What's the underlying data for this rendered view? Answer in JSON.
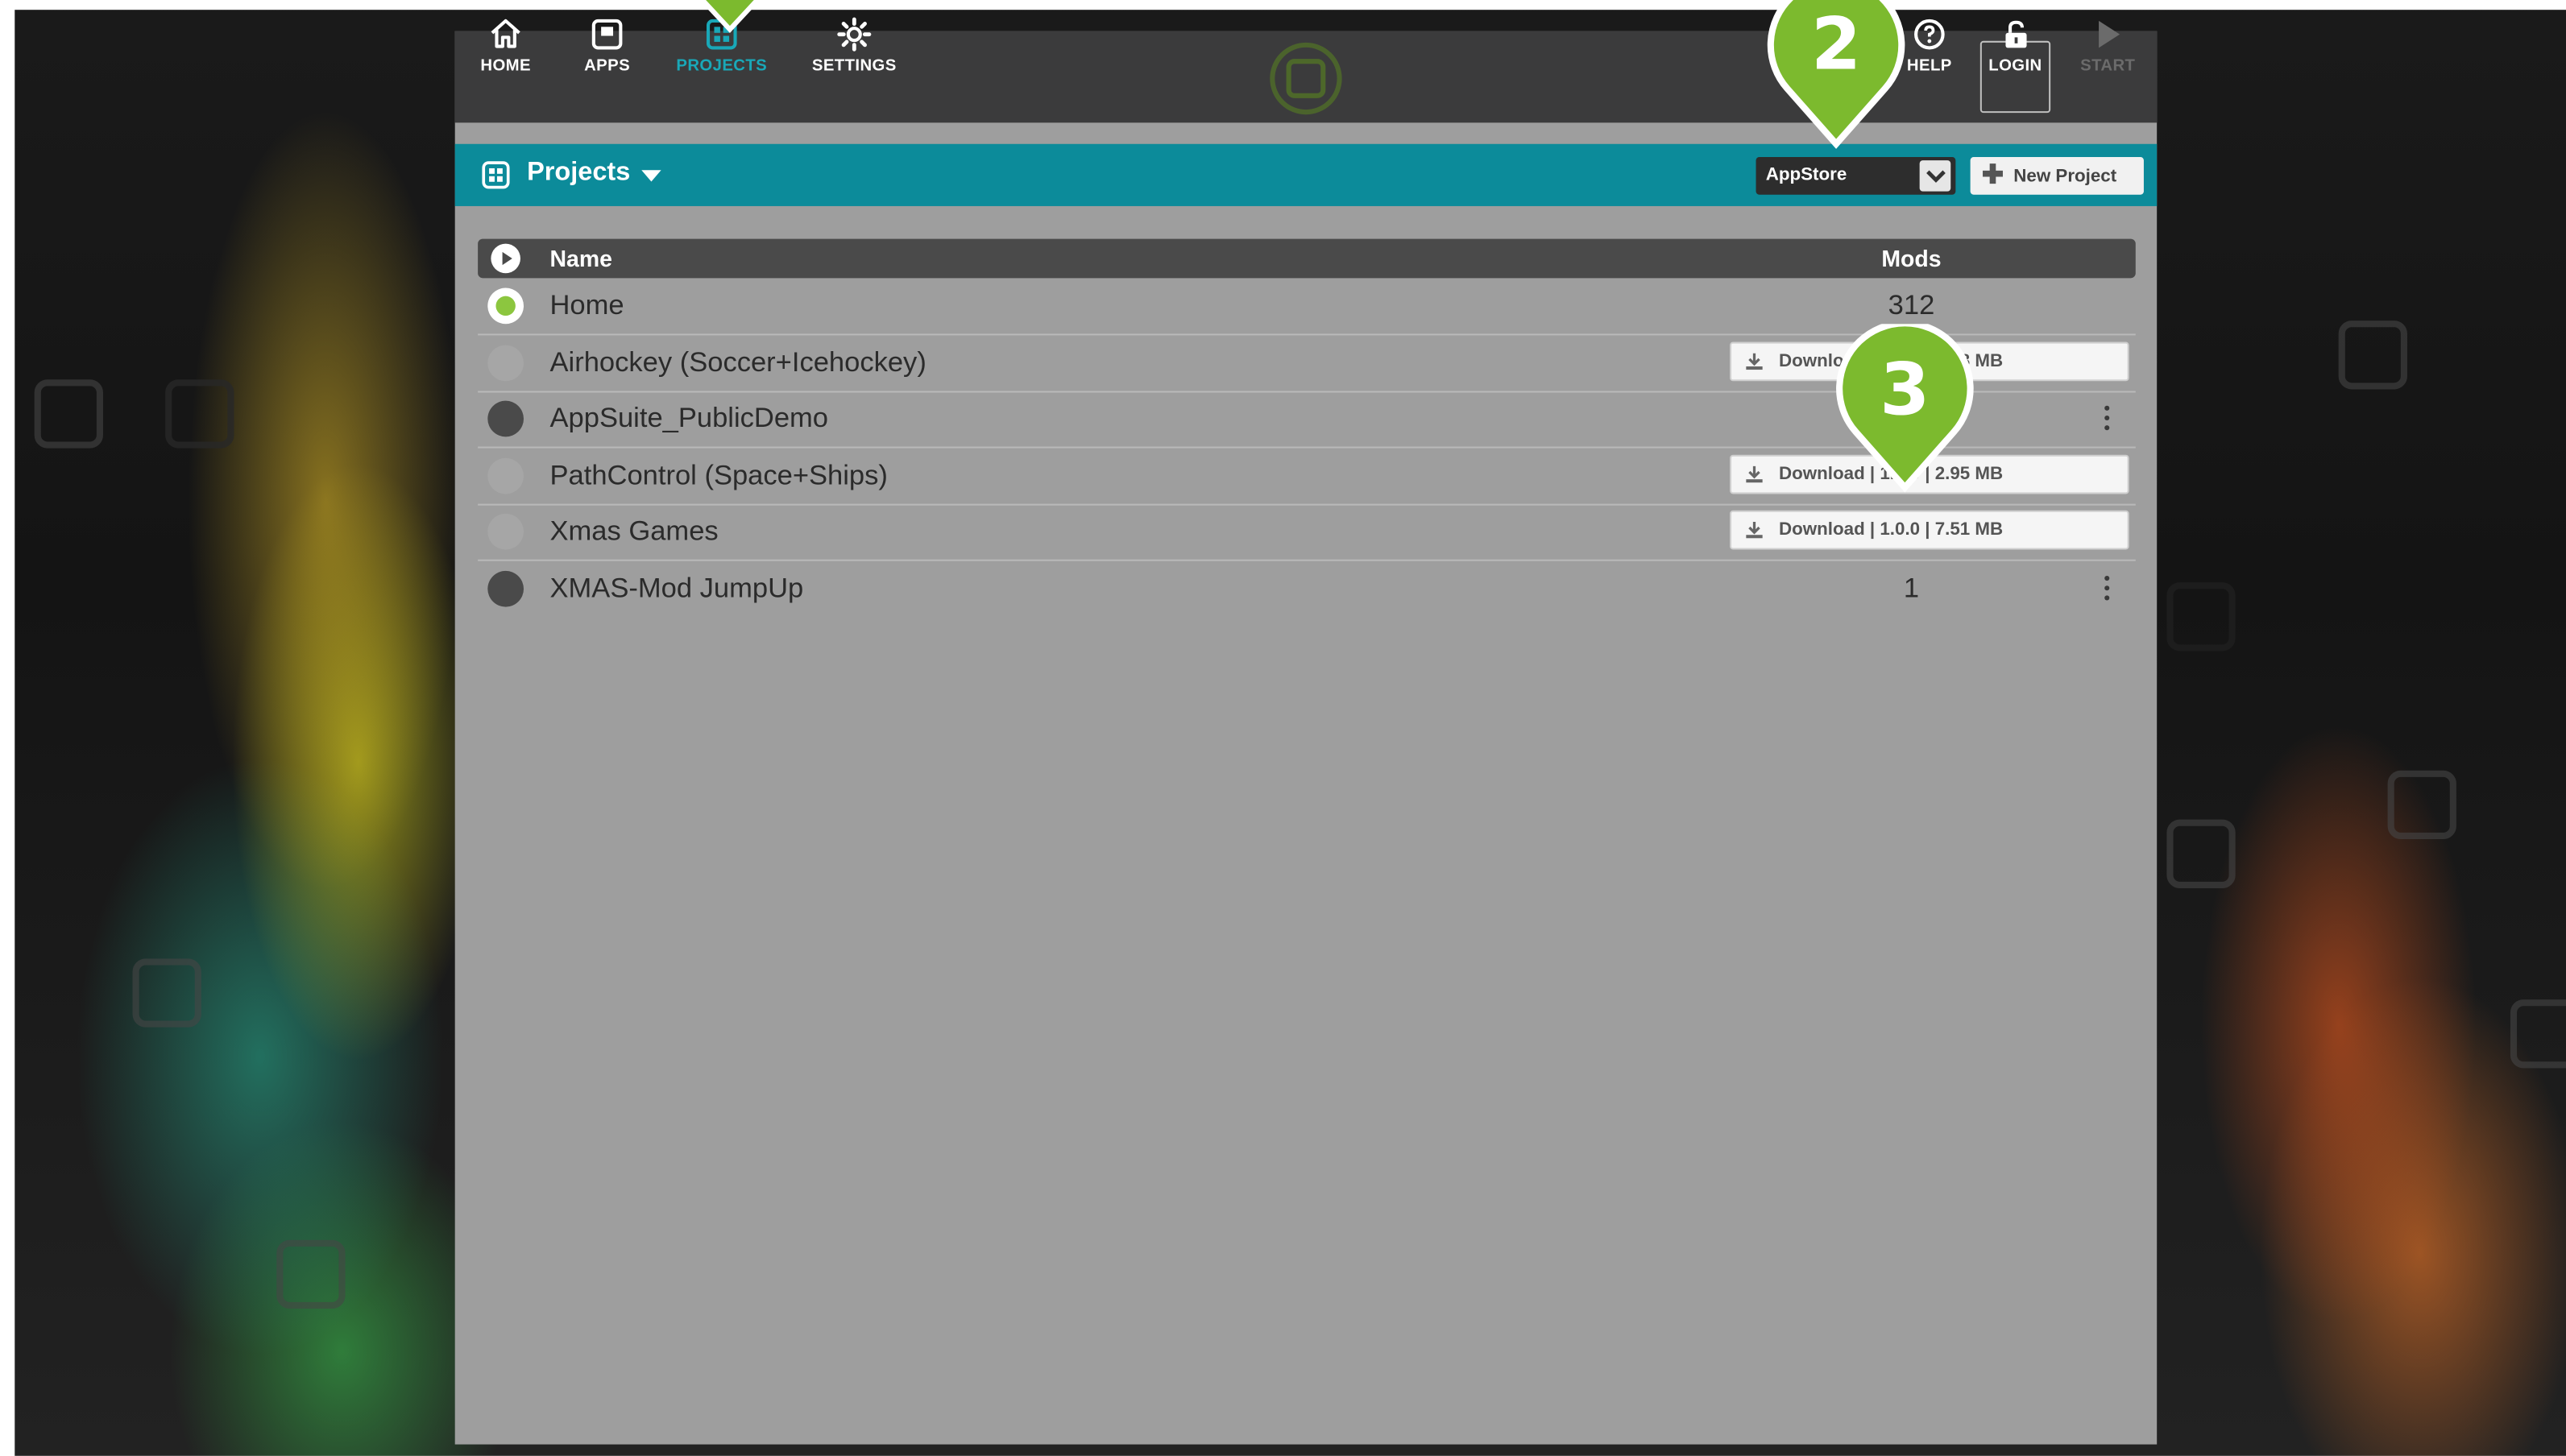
{
  "app": {
    "nav": [
      {
        "label": "HOME",
        "icon": "home-icon",
        "state": "normal"
      },
      {
        "label": "APPS",
        "icon": "apps-icon",
        "state": "normal"
      },
      {
        "label": "PROJECTS",
        "icon": "projects-icon",
        "state": "active"
      },
      {
        "label": "SETTINGS",
        "icon": "gear-icon",
        "state": "normal"
      }
    ],
    "nav_right": [
      {
        "label": "HELP",
        "icon": "help-icon",
        "state": "normal"
      },
      {
        "label": "LOGIN",
        "icon": "lock-open-icon",
        "state": "normal"
      },
      {
        "label": "START",
        "icon": "play-icon",
        "state": "disabled"
      }
    ]
  },
  "titlebar": {
    "title": "Projects",
    "store_select": {
      "value": "AppStore"
    },
    "new_project_label": "New Project"
  },
  "table": {
    "columns": {
      "name": "Name",
      "mods": "Mods"
    },
    "rows": [
      {
        "name": "Home",
        "mods": "312",
        "status": "selected",
        "action": null
      },
      {
        "name": "Airhockey (Soccer+Icehockey)",
        "mods": "",
        "status": "available",
        "action": "Download | 1.0.0 | 6.08 MB"
      },
      {
        "name": "AppSuite_PublicDemo",
        "mods": "",
        "status": "installed",
        "action": "menu"
      },
      {
        "name": "PathControl (Space+Ships)",
        "mods": "",
        "status": "available",
        "action": "Download | 1.0.0 | 2.95 MB"
      },
      {
        "name": "Xmas Games",
        "mods": "",
        "status": "available",
        "action": "Download | 1.0.0 | 7.51 MB"
      },
      {
        "name": "XMAS-Mod JumpUp",
        "mods": "1",
        "status": "installed",
        "action": "menu"
      }
    ]
  },
  "callouts": [
    {
      "number": "2"
    },
    {
      "number": "3"
    }
  ],
  "colors": {
    "accent": "#0c8b9a",
    "active_nav": "#19a8b8",
    "callout_green": "#7cba2e",
    "selected_dot": "#8cc63f"
  }
}
